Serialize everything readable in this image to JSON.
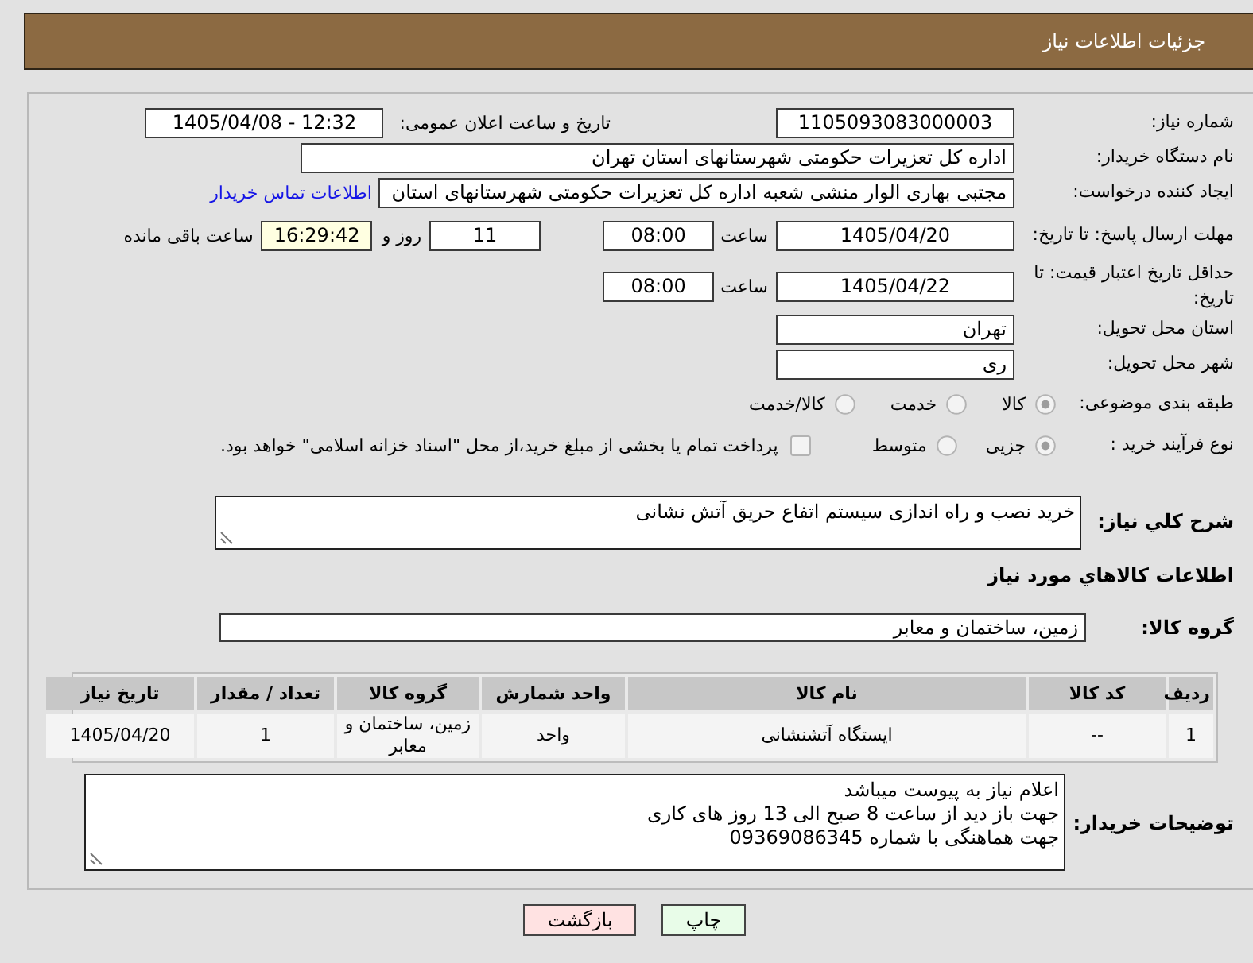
{
  "header": {
    "title": "جزئیات اطلاعات نیاز"
  },
  "details": {
    "need_number": {
      "label": "شماره نیاز:",
      "value": "1105093083000003"
    },
    "announce": {
      "label": "تاریخ و ساعت اعلان عمومی:",
      "value": "1405/04/08 - 12:32"
    },
    "buyer_org": {
      "label": "نام دستگاه خریدار:",
      "value": "اداره کل تعزیرات حکومتی شهرستانهای استان تهران"
    },
    "requester": {
      "label": "ایجاد کننده درخواست:",
      "value": "مجتبی بهاری الوار منشی شعبه اداره کل تعزیرات حکومتی شهرستانهای استان",
      "contact_link": "اطلاعات تماس خریدار"
    },
    "response_deadline": {
      "label": "مهلت ارسال پاسخ: تا تاریخ:",
      "date": "1405/04/20",
      "time_label": "ساعت",
      "time": "08:00",
      "days": "11",
      "days_label": "روز و",
      "remaining": "16:29:42",
      "remaining_label": "ساعت باقی مانده"
    },
    "price_validity": {
      "label": "حداقل تاریخ اعتبار قیمت: تا تاریخ:",
      "date": "1405/04/22",
      "time_label": "ساعت",
      "time": "08:00"
    },
    "delivery_province": {
      "label": "استان محل تحویل:",
      "value": "تهران"
    },
    "delivery_city": {
      "label": "شهر محل تحویل:",
      "value": "ری"
    },
    "category": {
      "label": "طبقه بندی موضوعی:",
      "options": [
        {
          "label": "کالا",
          "selected": true
        },
        {
          "label": "خدمت",
          "selected": false
        },
        {
          "label": "کالا/خدمت",
          "selected": false
        }
      ]
    },
    "process": {
      "label": "نوع فرآیند خرید :",
      "options": [
        {
          "label": "جزیی",
          "selected": true
        },
        {
          "label": "متوسط",
          "selected": false
        }
      ],
      "treasury_payment": {
        "label": "پرداخت تمام یا بخشی از مبلغ خرید،از محل \"اسناد خزانه اسلامی\" خواهد بود.",
        "checked": false
      }
    }
  },
  "description": {
    "label": "شرح كلي نياز:",
    "value": "خرید نصب و راه اندازی سیستم اتفاع حریق آتش نشانی"
  },
  "goods": {
    "heading": "اطلاعات كالاهاي مورد نياز",
    "group_label": "گروه کالا:",
    "group": "زمین، ساختمان و معابر",
    "table": {
      "columns": [
        "ردیف",
        "کد کالا",
        "نام کالا",
        "واحد شمارش",
        "گروه کالا",
        "تعداد / مقدار",
        "تاریخ نیاز"
      ],
      "rows": [
        [
          "1",
          "--",
          "ایستگاه آتشنشانی",
          "واحد",
          "زمین، ساختمان و معابر",
          "1",
          "1405/04/20"
        ]
      ]
    }
  },
  "buyer_notes": {
    "label": "توضیحات خریدار:",
    "lines": [
      "اعلام نیاز به پیوست میباشد",
      "جهت باز دید از ساعت 8 صبح الی 13 روز های کاری",
      "جهت هماهنگی با شماره 09369086345"
    ]
  },
  "buttons": [
    {
      "label": "چاپ",
      "kind": "print"
    },
    {
      "label": "بازگشت",
      "kind": "back"
    }
  ]
}
